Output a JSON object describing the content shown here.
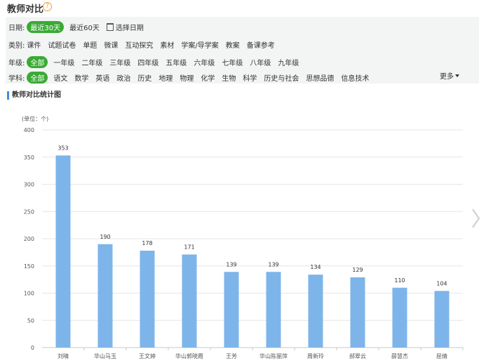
{
  "page": {
    "title": "教师对比",
    "help_icon": "question-circle-icon"
  },
  "filters": {
    "date": {
      "label": "日期:",
      "options": [
        "最近30天",
        "最近60天"
      ],
      "selected": 0,
      "pick_label": "选择日期",
      "pick_icon": "calendar-icon"
    },
    "category": {
      "label": "类别:",
      "options": [
        "课件",
        "试题试卷",
        "单题",
        "微课",
        "互动探究",
        "素材",
        "学案/导学案",
        "教案",
        "备课参考"
      ]
    },
    "grade": {
      "label": "年级:",
      "options": [
        "全部",
        "一年级",
        "二年级",
        "三年级",
        "四年级",
        "五年级",
        "六年级",
        "七年级",
        "八年级",
        "九年级"
      ],
      "selected": 0
    },
    "subject": {
      "label": "学科:",
      "options": [
        "全部",
        "语文",
        "数学",
        "英语",
        "政治",
        "历史",
        "地理",
        "物理",
        "化学",
        "生物",
        "科学",
        "历史与社会",
        "思想品德",
        "信息技术"
      ],
      "selected": 0,
      "more_label": "更多"
    }
  },
  "section": {
    "title": "教师对比统计图"
  },
  "accent_color": "#3aaa35",
  "bar_color": "#7db4ea",
  "chart_data": {
    "type": "bar",
    "unit_label": "(单位：个)",
    "categories": [
      "刘晴",
      "华山马玉",
      "王文婷",
      "华山郭晓霞",
      "王芳",
      "华山陈丽萍",
      "周新玲",
      "郝翠云",
      "薛慧杰",
      "屈倩"
    ],
    "values": [
      353,
      190,
      178,
      171,
      139,
      139,
      134,
      129,
      110,
      104
    ],
    "yticks": [
      0,
      50,
      100,
      150,
      200,
      250,
      300,
      350,
      400
    ],
    "ylim": [
      0,
      400
    ],
    "grid": true
  },
  "nav": {
    "next_icon": "chevron-right-icon"
  }
}
